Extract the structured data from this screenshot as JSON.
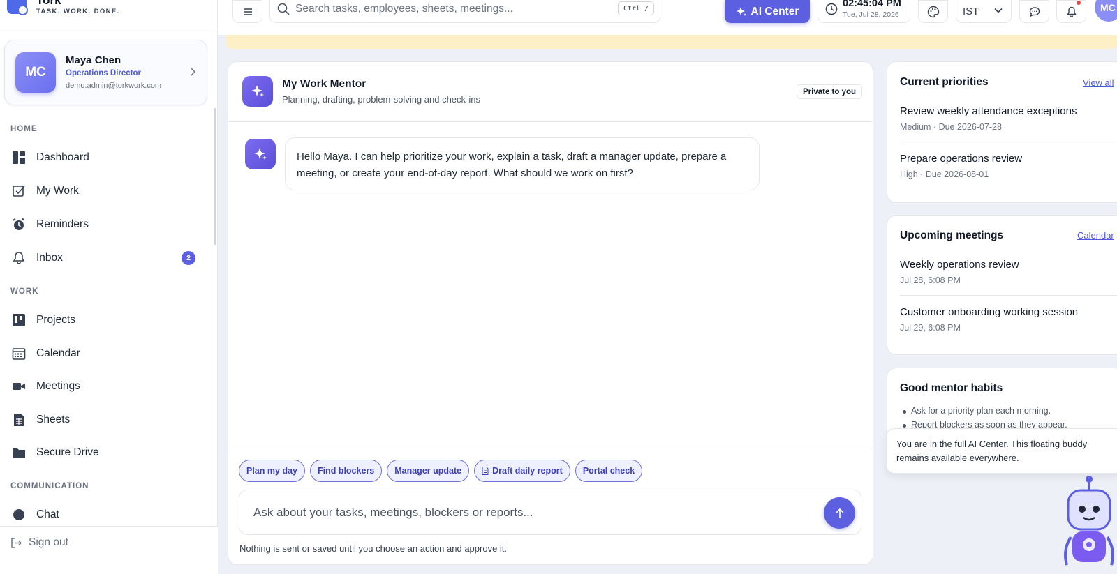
{
  "brand": {
    "name": "Tork",
    "tagline": "TASK. WORK. DONE."
  },
  "profile": {
    "initials": "MC",
    "name": "Maya Chen",
    "role": "Operations Director",
    "email": "demo.admin@torkwork.com"
  },
  "sidebar": {
    "sections": [
      {
        "title": "HOME",
        "items": [
          {
            "label": "Dashboard",
            "icon": "dashboard-icon"
          },
          {
            "label": "My Work",
            "icon": "checkbox-icon"
          },
          {
            "label": "Reminders",
            "icon": "alarm-clock-icon"
          },
          {
            "label": "Inbox",
            "icon": "bell-icon",
            "badge": "2"
          }
        ]
      },
      {
        "title": "WORK",
        "items": [
          {
            "label": "Projects",
            "icon": "kanban-icon"
          },
          {
            "label": "Calendar",
            "icon": "calendar-icon"
          },
          {
            "label": "Meetings",
            "icon": "video-camera-icon"
          },
          {
            "label": "Sheets",
            "icon": "spreadsheet-icon"
          },
          {
            "label": "Secure Drive",
            "icon": "folder-icon"
          }
        ]
      },
      {
        "title": "COMMUNICATION",
        "items": [
          {
            "label": "Chat",
            "icon": "chat-icon"
          }
        ]
      }
    ],
    "sign_out": "Sign out"
  },
  "header": {
    "search_placeholder": "Search tasks, employees, sheets, meetings...",
    "search_shortcut": "Ctrl /",
    "ai_center": "AI Center",
    "time": "02:45:04 PM",
    "date": "Tue, Jul 28, 2026",
    "timezone": "IST",
    "user_initials": "MC"
  },
  "mentor": {
    "title": "My Work Mentor",
    "subtitle": "Planning, drafting, problem-solving and check-ins",
    "privacy_badge": "Private to you",
    "greeting": "Hello Maya. I can help prioritize your work, explain a task, draft a manager update, prepare a meeting, or create your end-of-day report. What should we work on first?",
    "chips": [
      "Plan my day",
      "Find blockers",
      "Manager update",
      "Draft daily report",
      "Portal check"
    ],
    "input_placeholder": "Ask about your tasks, meetings, blockers or reports...",
    "disclaimer": "Nothing is sent or saved until you choose an action and approve it."
  },
  "priorities": {
    "title": "Current priorities",
    "link": "View all",
    "items": [
      {
        "title": "Review weekly attendance exceptions",
        "meta": "Medium · Due 2026-07-28"
      },
      {
        "title": "Prepare operations review",
        "meta": "High · Due 2026-08-01"
      }
    ]
  },
  "meetings": {
    "title": "Upcoming meetings",
    "link": "Calendar",
    "items": [
      {
        "title": "Weekly operations review",
        "meta": "Jul 28, 6:08 PM"
      },
      {
        "title": "Customer onboarding working session",
        "meta": "Jul 29, 6:08 PM"
      }
    ]
  },
  "habits": {
    "title": "Good mentor habits",
    "items": [
      "Ask for a priority plan each morning.",
      "Report blockers as soon as they appear."
    ]
  },
  "buddy_tooltip": "You are in the full AI Center. This floating buddy remains available everywhere.",
  "colors": {
    "accent": "#5b5fe0",
    "banner": "#fdf0c6",
    "background": "#eef0f8"
  }
}
